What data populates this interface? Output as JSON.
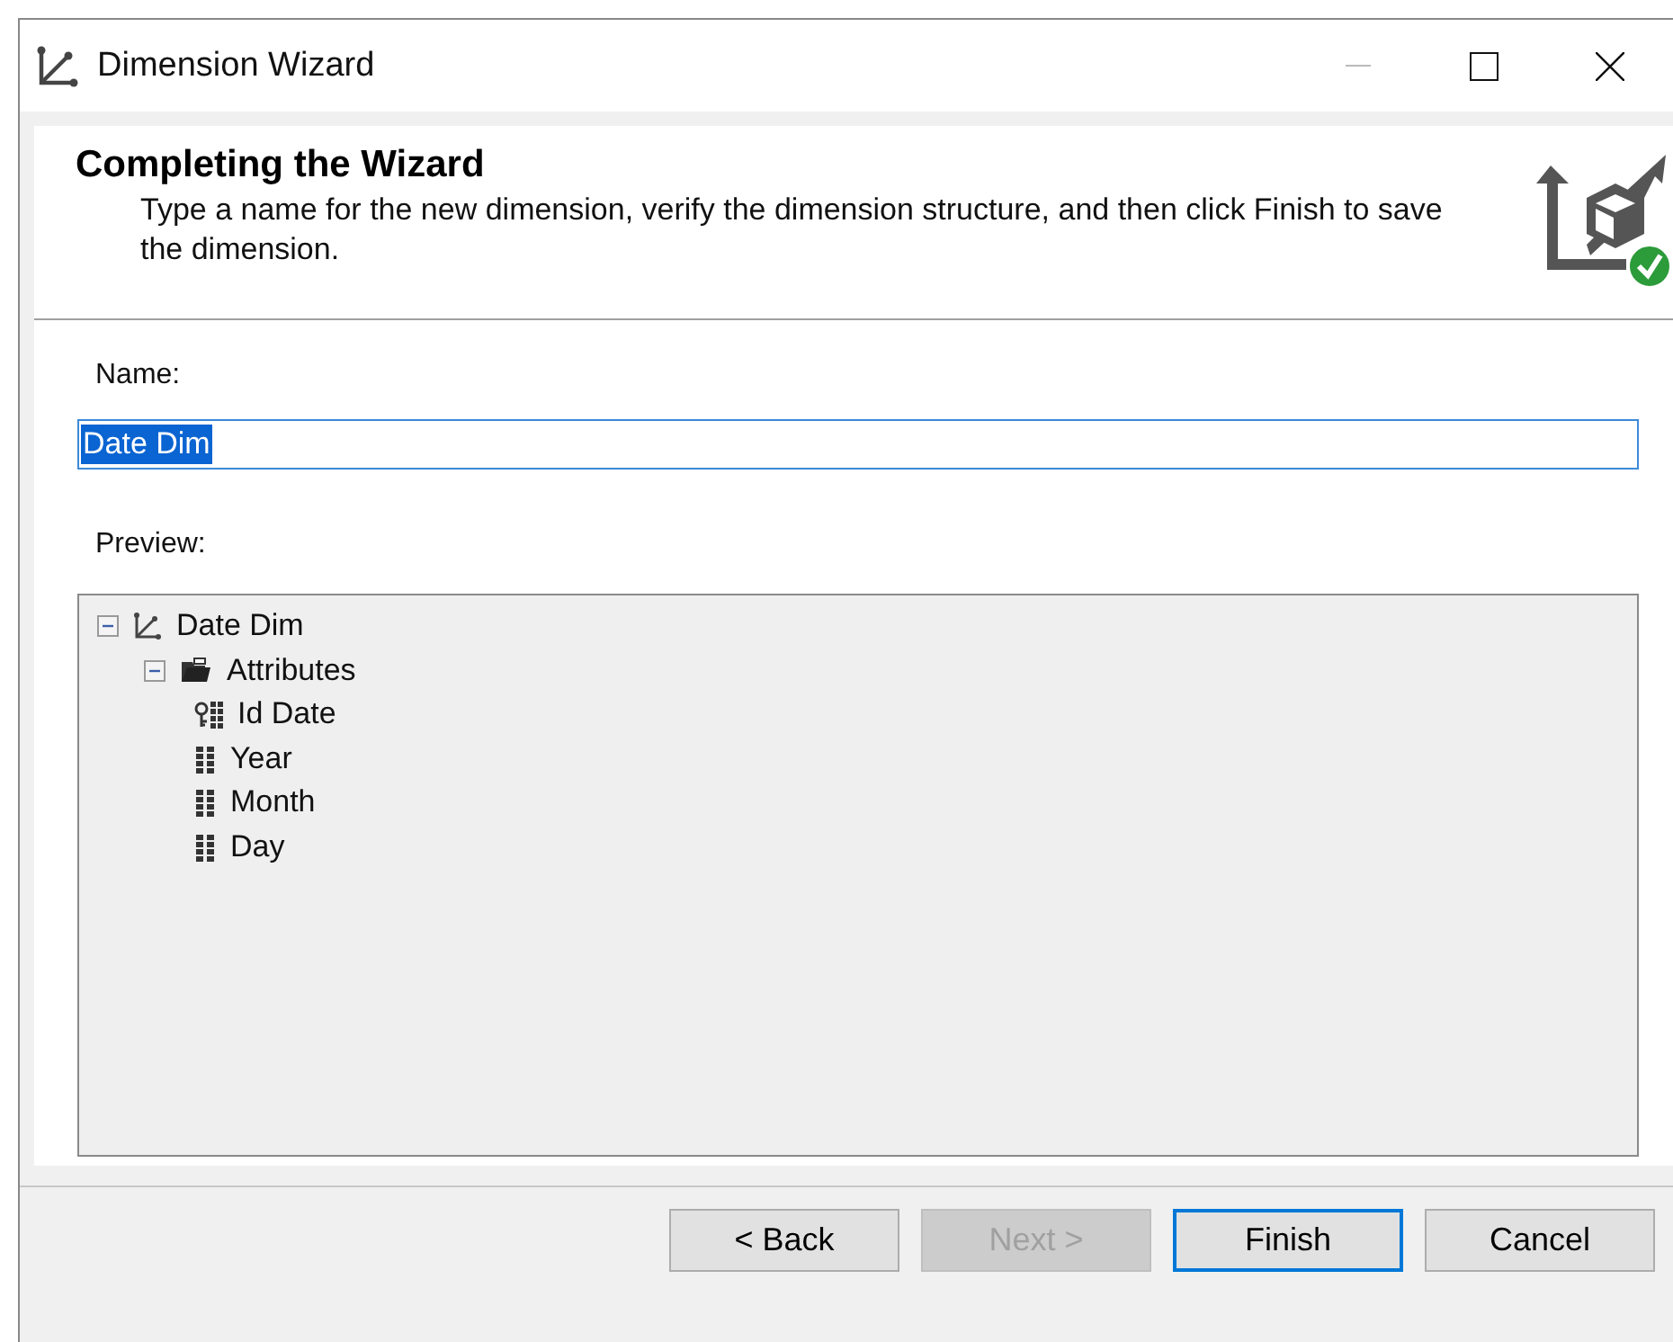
{
  "window": {
    "title": "Dimension Wizard"
  },
  "header": {
    "title": "Completing the Wizard",
    "description": "Type a name for the new dimension, verify the dimension structure, and then click Finish to save the dimension."
  },
  "name_field": {
    "label": "Name:",
    "value": "Date Dim",
    "selected": true
  },
  "preview": {
    "label": "Preview:",
    "tree": [
      {
        "label": "Date Dim",
        "kind": "dimension",
        "expanded": true,
        "children": [
          {
            "label": "Attributes",
            "kind": "folder",
            "expanded": true,
            "children": [
              {
                "label": "Id Date",
                "kind": "key"
              },
              {
                "label": "Year",
                "kind": "attribute"
              },
              {
                "label": "Month",
                "kind": "attribute"
              },
              {
                "label": "Day",
                "kind": "attribute"
              }
            ]
          }
        ]
      }
    ]
  },
  "buttons": [
    {
      "label": "< Back",
      "disabled": false,
      "default": false
    },
    {
      "label": "Next >",
      "disabled": true,
      "default": false
    },
    {
      "label": "Finish",
      "disabled": false,
      "default": true
    },
    {
      "label": "Cancel",
      "disabled": false,
      "default": false
    }
  ]
}
